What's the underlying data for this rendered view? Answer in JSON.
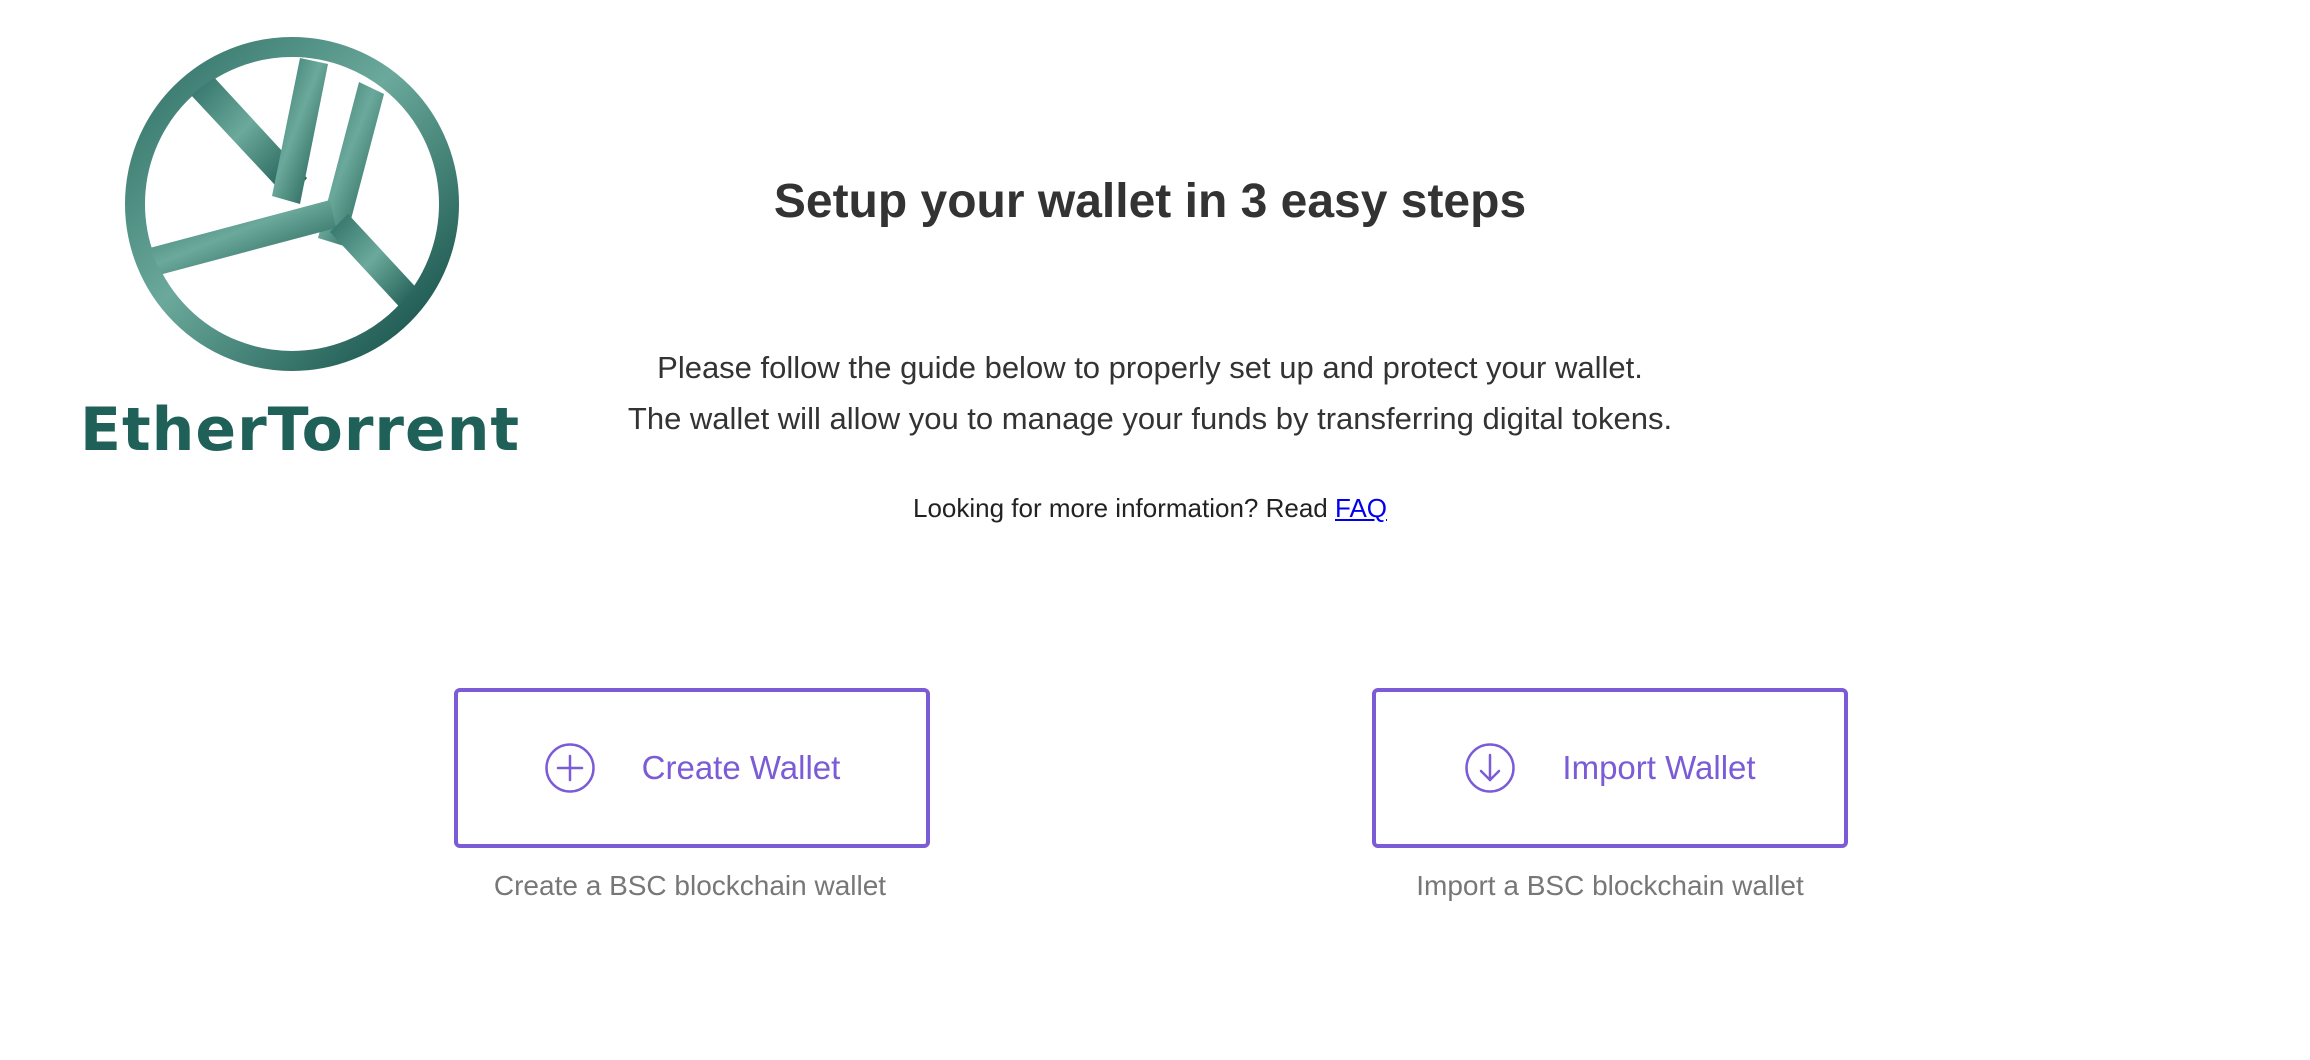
{
  "brand": {
    "name": "EtherTorrent",
    "logo_icon": "ethertorrent-logo-icon",
    "color_light": "#6aa99b",
    "color_dark": "#0f4a43"
  },
  "header": {
    "title": "Setup your wallet in 3 easy steps"
  },
  "intro": {
    "line1": "Please follow the guide below to properly set up and protect your wallet.",
    "line2": "The wallet will allow you to manage your funds by transferring digital tokens."
  },
  "info": {
    "prefix": "Looking for more information? Read",
    "faq_label": "FAQ"
  },
  "actions": {
    "create": {
      "label": "Create Wallet",
      "icon": "plus-circle-icon",
      "caption": "Create a BSC blockchain wallet"
    },
    "import": {
      "label": "Import Wallet",
      "icon": "arrow-down-circle-icon",
      "caption": "Import a BSC blockchain wallet"
    }
  },
  "colors": {
    "accent": "#7b5cd6",
    "text": "#333333",
    "caption": "#777777",
    "link": "#0000ee"
  }
}
